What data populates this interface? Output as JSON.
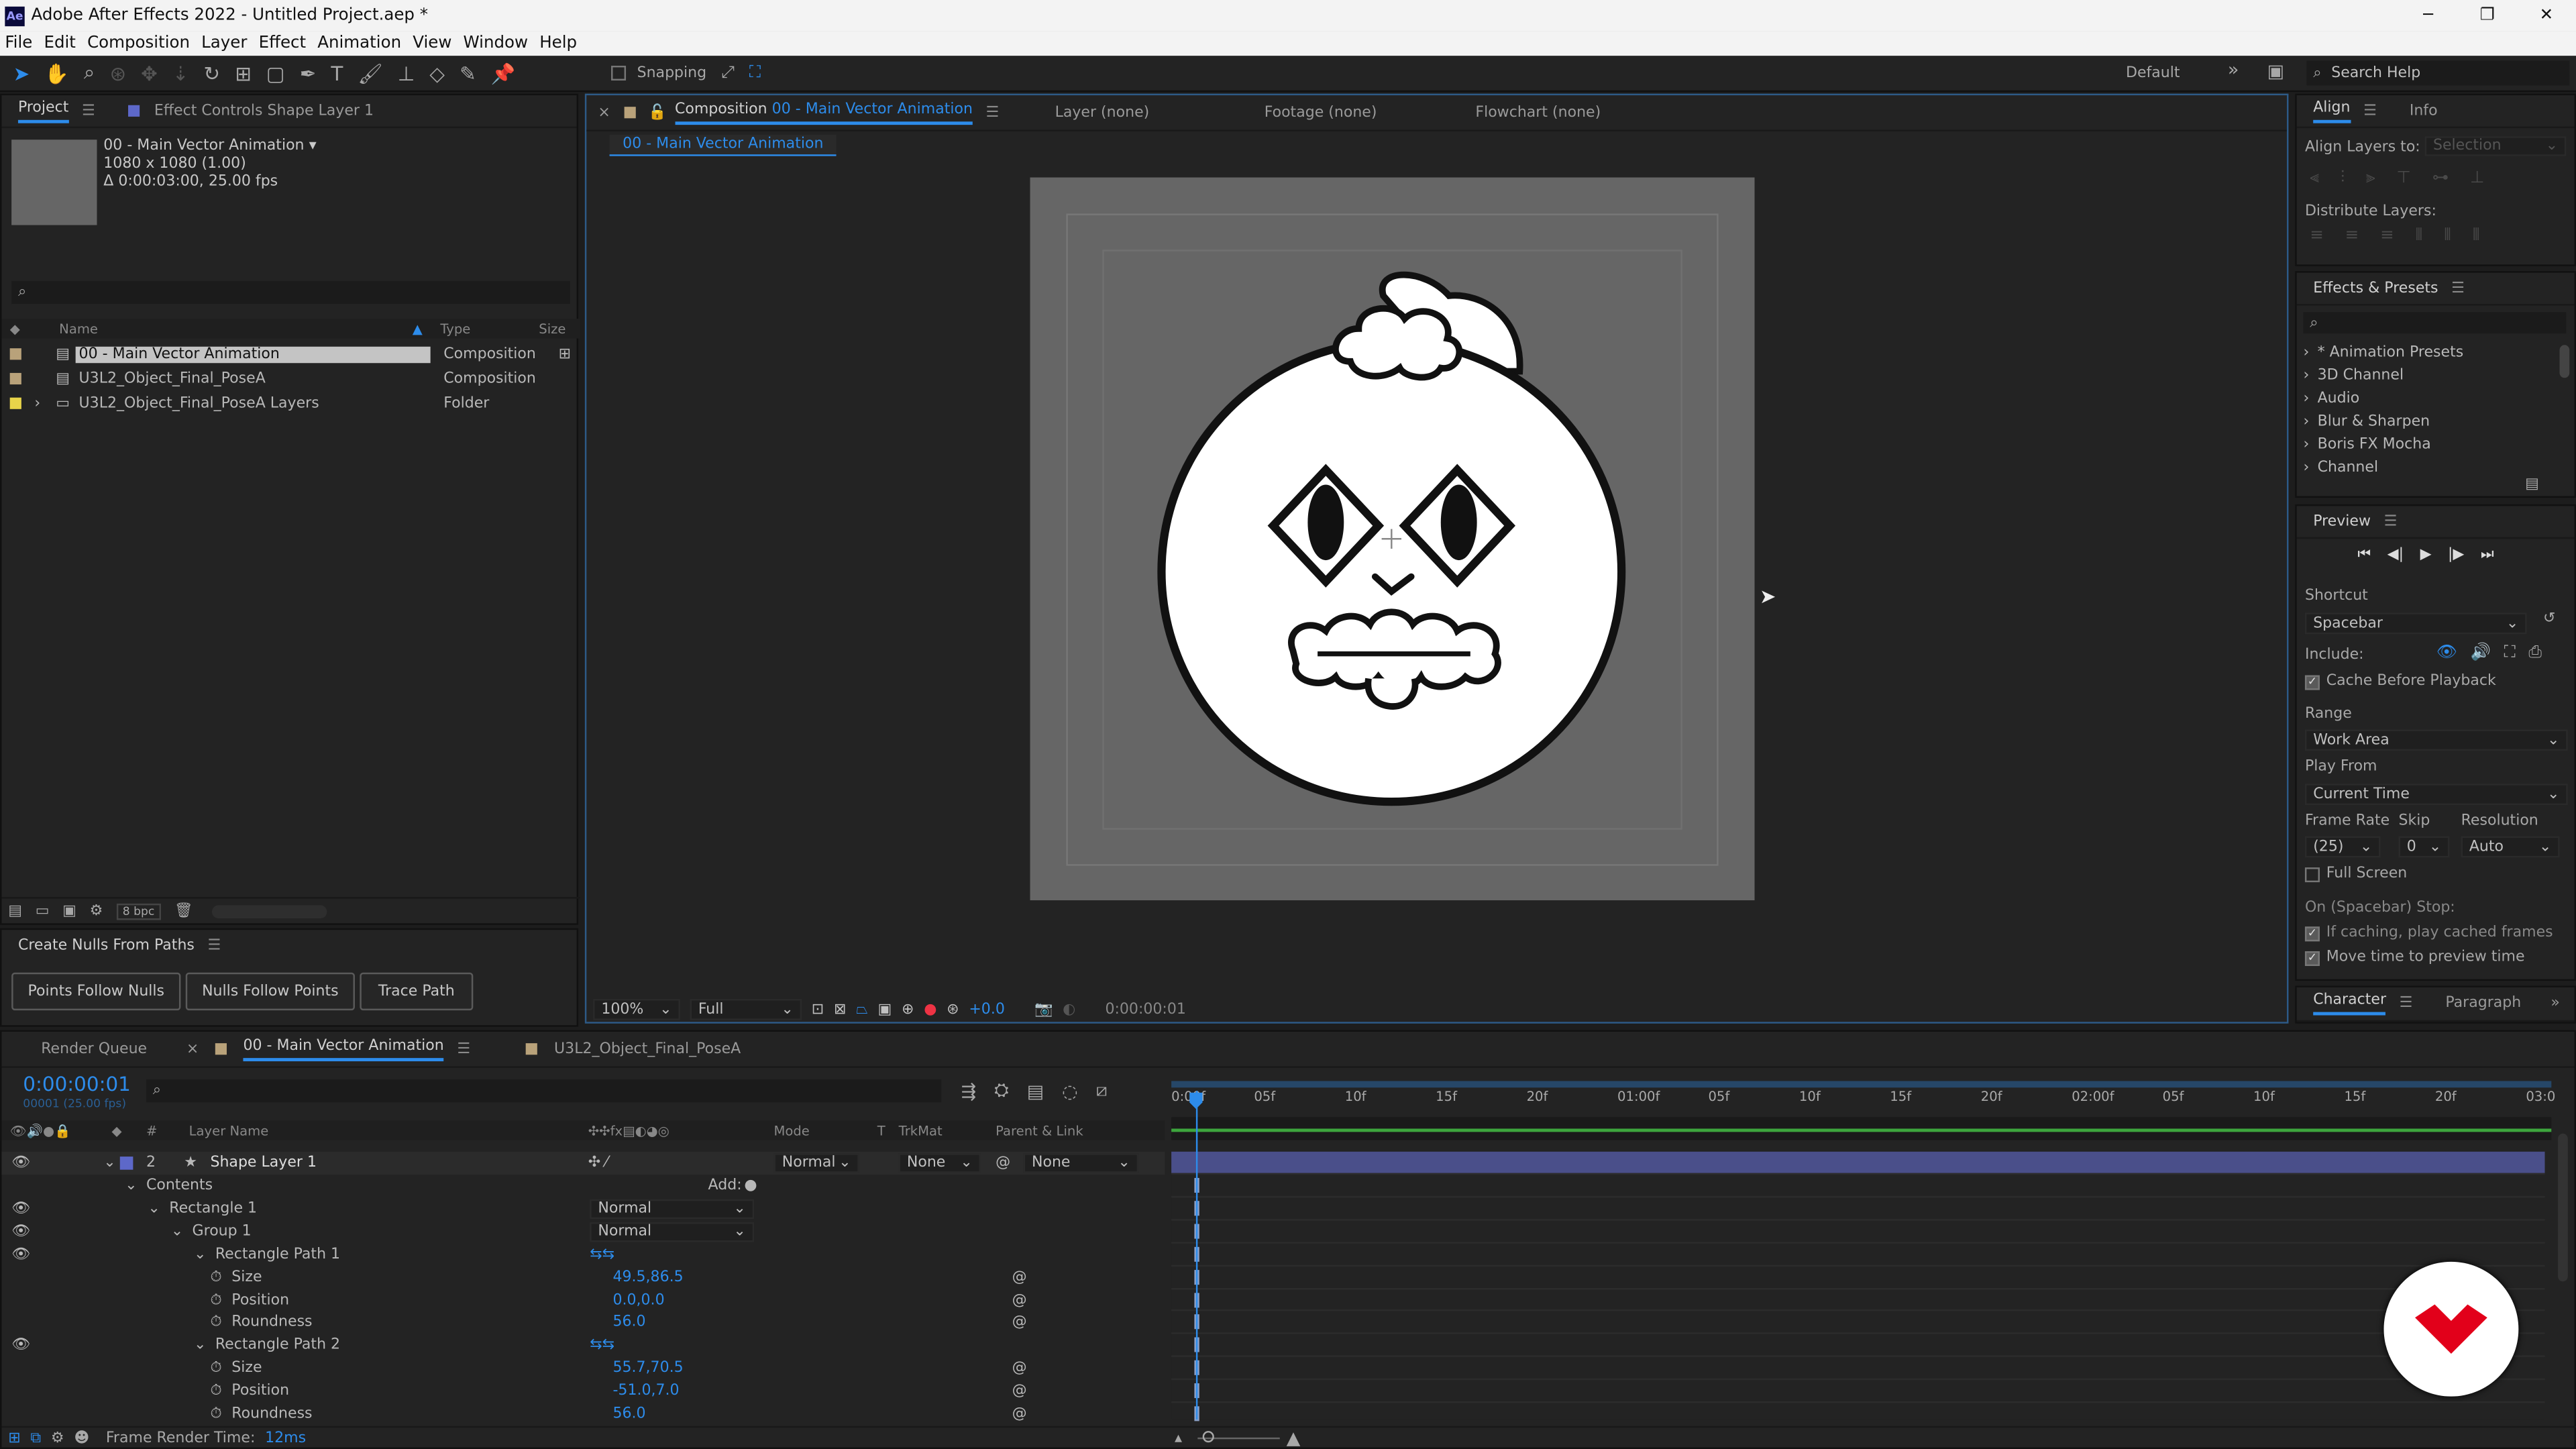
{
  "window": {
    "app_icon": "Ae",
    "title": "Adobe After Effects 2022 - Untitled Project.aep *"
  },
  "menu": [
    "File",
    "Edit",
    "Composition",
    "Layer",
    "Effect",
    "Animation",
    "View",
    "Window",
    "Help"
  ],
  "toolbar": {
    "snapping": "Snapping",
    "workspace": "Default",
    "search_placeholder": "Search Help"
  },
  "project": {
    "tabs": [
      "Project",
      "Effect Controls Shape Layer 1"
    ],
    "preview": {
      "name": "00 - Main Vector Animation",
      "dims": "1080 x 1080 (1.00)",
      "duration": "Δ 0:00:03:00, 25.00 fps"
    },
    "columns": [
      "Name",
      "Type",
      "Size"
    ],
    "items": [
      {
        "name": "00 - Main Vector Animation",
        "type": "Composition",
        "label_color": "#b9a27a"
      },
      {
        "name": "U3L2_Object_Final_PoseA",
        "type": "Composition",
        "label_color": "#b9a27a"
      },
      {
        "name": "U3L2_Object_Final_PoseA Layers",
        "type": "Folder",
        "label_color": "#e8d44a"
      }
    ],
    "bpc": "8 bpc"
  },
  "nulls": {
    "title": "Create Nulls From Paths",
    "buttons": [
      "Points Follow Nulls",
      "Nulls Follow Points",
      "Trace Path"
    ]
  },
  "comp": {
    "tab_prefix": "Composition",
    "tab_name": "00 - Main Vector Animation",
    "other_tabs": [
      "Layer  (none)",
      "Footage  (none)",
      "Flowchart  (none)"
    ],
    "breadcrumb": "00 - Main Vector Animation",
    "zoom": "100%",
    "resolution": "Full",
    "exposure": "+0.0",
    "timecode": "0:00:00:01"
  },
  "align": {
    "tabs": [
      "Align",
      "Info"
    ],
    "align_to_label": "Align Layers to:",
    "align_to_value": "Selection",
    "distribute": "Distribute Layers:"
  },
  "effects": {
    "title": "Effects & Presets",
    "items": [
      "* Animation Presets",
      "3D Channel",
      "Audio",
      "Blur & Sharpen",
      "Boris FX Mocha",
      "Channel"
    ]
  },
  "preview": {
    "title": "Preview",
    "shortcut_label": "Shortcut",
    "shortcut": "Spacebar",
    "include": "Include:",
    "cache": "Cache Before Playback",
    "range_label": "Range",
    "range": "Work Area",
    "play_from_label": "Play From",
    "play_from": "Current Time",
    "frame_rate_label": "Frame Rate",
    "skip_label": "Skip",
    "resolution_label": "Resolution",
    "frame_rate": "(25)",
    "skip": "0",
    "resolution": "Auto",
    "full_screen": "Full Screen",
    "stop_label": "On (Spacebar) Stop:",
    "if_caching": "If caching, play cached frames",
    "move_time": "Move time to preview time"
  },
  "character": {
    "tabs": [
      "Character",
      "Paragraph"
    ]
  },
  "timeline": {
    "tabs": [
      "Render Queue",
      "00 - Main Vector Animation",
      "U3L2_Object_Final_PoseA"
    ],
    "timecode": "0:00:00:01",
    "fps": "00001 (25.00 fps)",
    "columns": {
      "layer_name": "Layer Name",
      "mode": "Mode",
      "t": "T",
      "trkmat": "TrkMat",
      "parent": "Parent & Link"
    },
    "ruler": [
      "0:00f",
      "05f",
      "10f",
      "15f",
      "20f",
      "01:00f",
      "05f",
      "10f",
      "15f",
      "20f",
      "02:00f",
      "05f",
      "10f",
      "15f",
      "20f",
      "03:0"
    ],
    "layer": {
      "num": "2",
      "name": "Shape Layer 1",
      "mode": "Normal",
      "trkmat": "None",
      "parent": "None"
    },
    "rows": [
      {
        "indent": 0,
        "label": "Contents",
        "eye": false,
        "add": "Add:"
      },
      {
        "indent": 1,
        "label": "Rectangle 1",
        "eye": true,
        "mode": "Normal"
      },
      {
        "indent": 2,
        "label": "Group 1",
        "eye": true,
        "mode": "Normal"
      },
      {
        "indent": 3,
        "label": "Rectangle Path 1",
        "eye": true
      },
      {
        "indent": 4,
        "label": "Size",
        "value": "49.5,86.5"
      },
      {
        "indent": 4,
        "label": "Position",
        "value": "0.0,0.0"
      },
      {
        "indent": 4,
        "label": "Roundness",
        "value": "56.0"
      },
      {
        "indent": 3,
        "label": "Rectangle Path 2",
        "eye": true
      },
      {
        "indent": 4,
        "label": "Size",
        "value": "55.7,70.5"
      },
      {
        "indent": 4,
        "label": "Position",
        "value": "-51.0,7.0"
      },
      {
        "indent": 4,
        "label": "Roundness",
        "value": "56.0"
      }
    ],
    "render_time_label": "Frame Render Time:",
    "render_time": "12ms"
  },
  "colors": {
    "accent": "#2d8ceb",
    "bg": "#1d1d1d",
    "panel": "#232323",
    "label_blue": "#5d68c9",
    "logo_red": "#e2001a"
  }
}
